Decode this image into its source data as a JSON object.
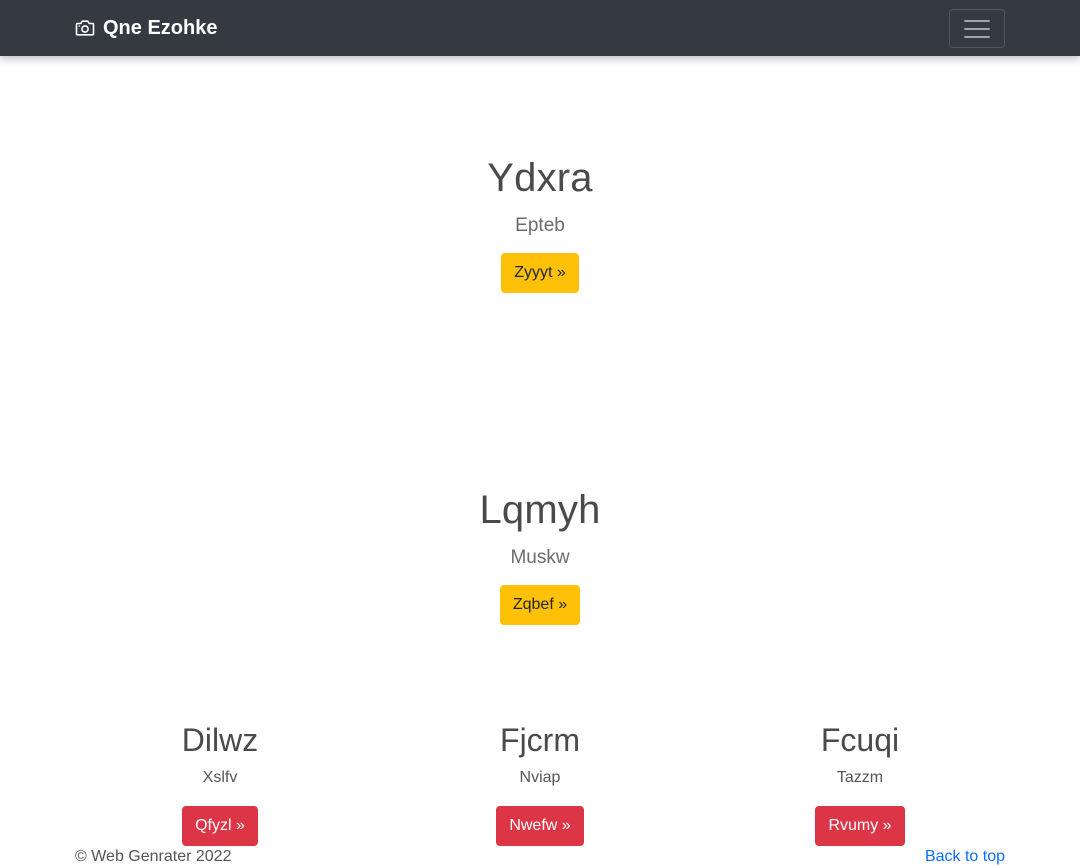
{
  "navbar": {
    "brand_icon": "camera-icon",
    "brand_label": "Qne Ezohke",
    "toggler_icon": "hamburger-menu-icon",
    "background": "#343a40"
  },
  "hero1": {
    "title": "Ydxra",
    "subtitle": "Epteb",
    "button_label": "Zyyyt »"
  },
  "hero2": {
    "title": "Lqmyh",
    "subtitle": "Muskw",
    "button_label": "Zqbef »"
  },
  "columns": [
    {
      "title": "Dilwz",
      "text": "Xslfv",
      "button_label": "Qfyzl »"
    },
    {
      "title": "Fjcrm",
      "text": "Nviap",
      "button_label": "Nwefw »"
    },
    {
      "title": "Fcuqi",
      "text": "Tazzm",
      "button_label": "Rvumy »"
    }
  ],
  "footer": {
    "copyright": "© Web Genrater 2022",
    "back_to_top": "Back to top"
  },
  "colors": {
    "warning": "#ffc107",
    "danger": "#dc3545",
    "link": "#0d6efd"
  }
}
